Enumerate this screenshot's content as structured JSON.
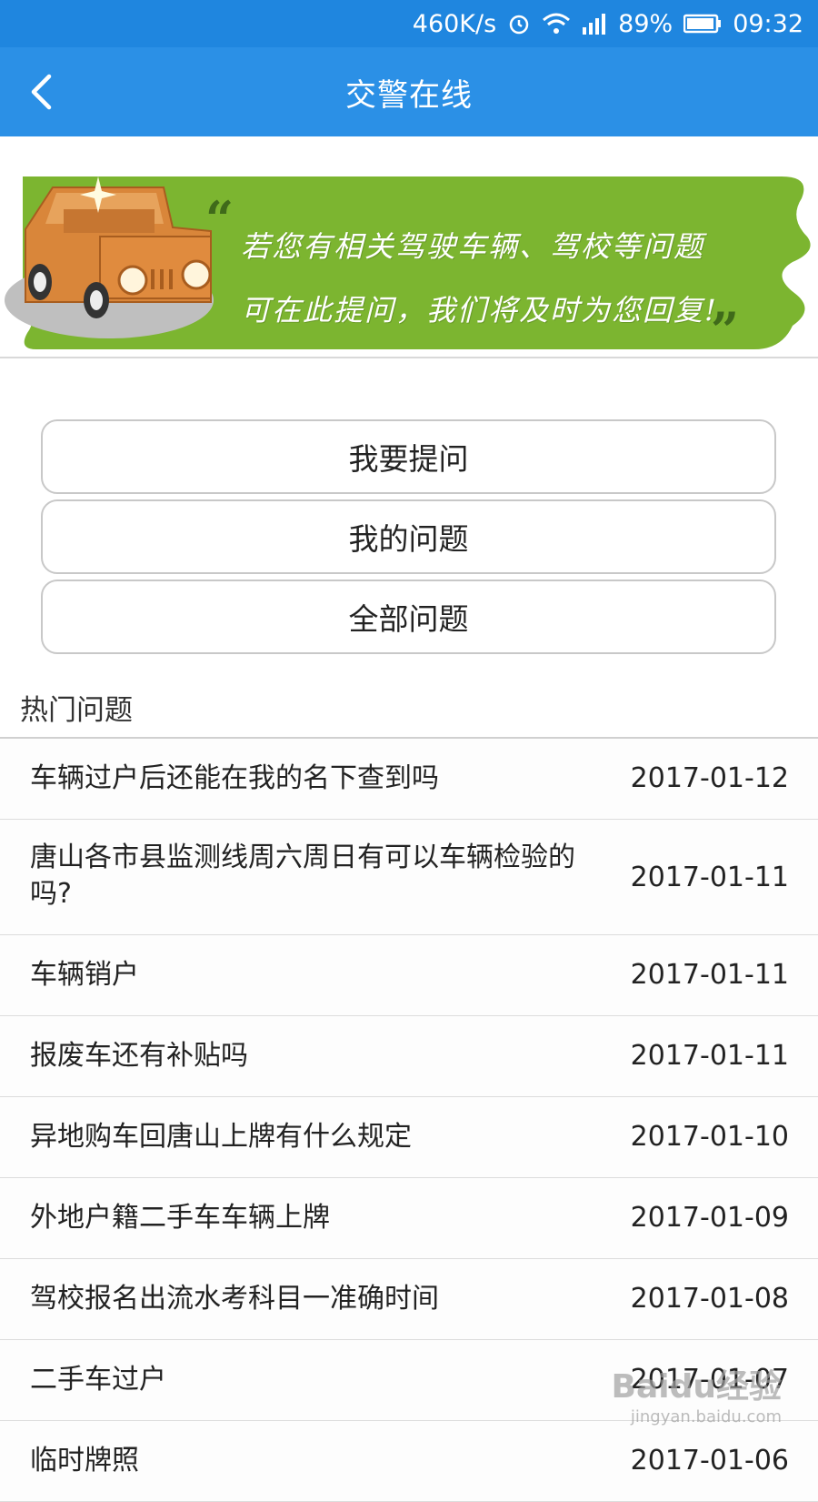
{
  "status_bar": {
    "speed": "460K/s",
    "battery": "89%",
    "time": "09:32"
  },
  "header": {
    "title": "交警在线"
  },
  "banner": {
    "line1": "若您有相关驾驶车辆、驾校等问题",
    "line2": "可在此提问，我们将及时为您回复!"
  },
  "buttons": {
    "ask": "我要提问",
    "mine": "我的问题",
    "all": "全部问题"
  },
  "hot": {
    "title": "热门问题",
    "items": [
      {
        "q": "车辆过户后还能在我的名下查到吗",
        "date": "2017-01-12"
      },
      {
        "q": "唐山各市县监测线周六周日有可以车辆检验的吗?",
        "date": "2017-01-11"
      },
      {
        "q": "车辆销户",
        "date": "2017-01-11"
      },
      {
        "q": "报废车还有补贴吗",
        "date": "2017-01-11"
      },
      {
        "q": "异地购车回唐山上牌有什么规定",
        "date": "2017-01-10"
      },
      {
        "q": "外地户籍二手车车辆上牌",
        "date": "2017-01-09"
      },
      {
        "q": "驾校报名出流水考科目一准确时间",
        "date": "2017-01-08"
      },
      {
        "q": "二手车过户",
        "date": "2017-01-07"
      },
      {
        "q": "临时牌照",
        "date": "2017-01-06"
      }
    ]
  },
  "watermark": {
    "brand": "Baidu经验",
    "url": "jingyan.baidu.com"
  }
}
